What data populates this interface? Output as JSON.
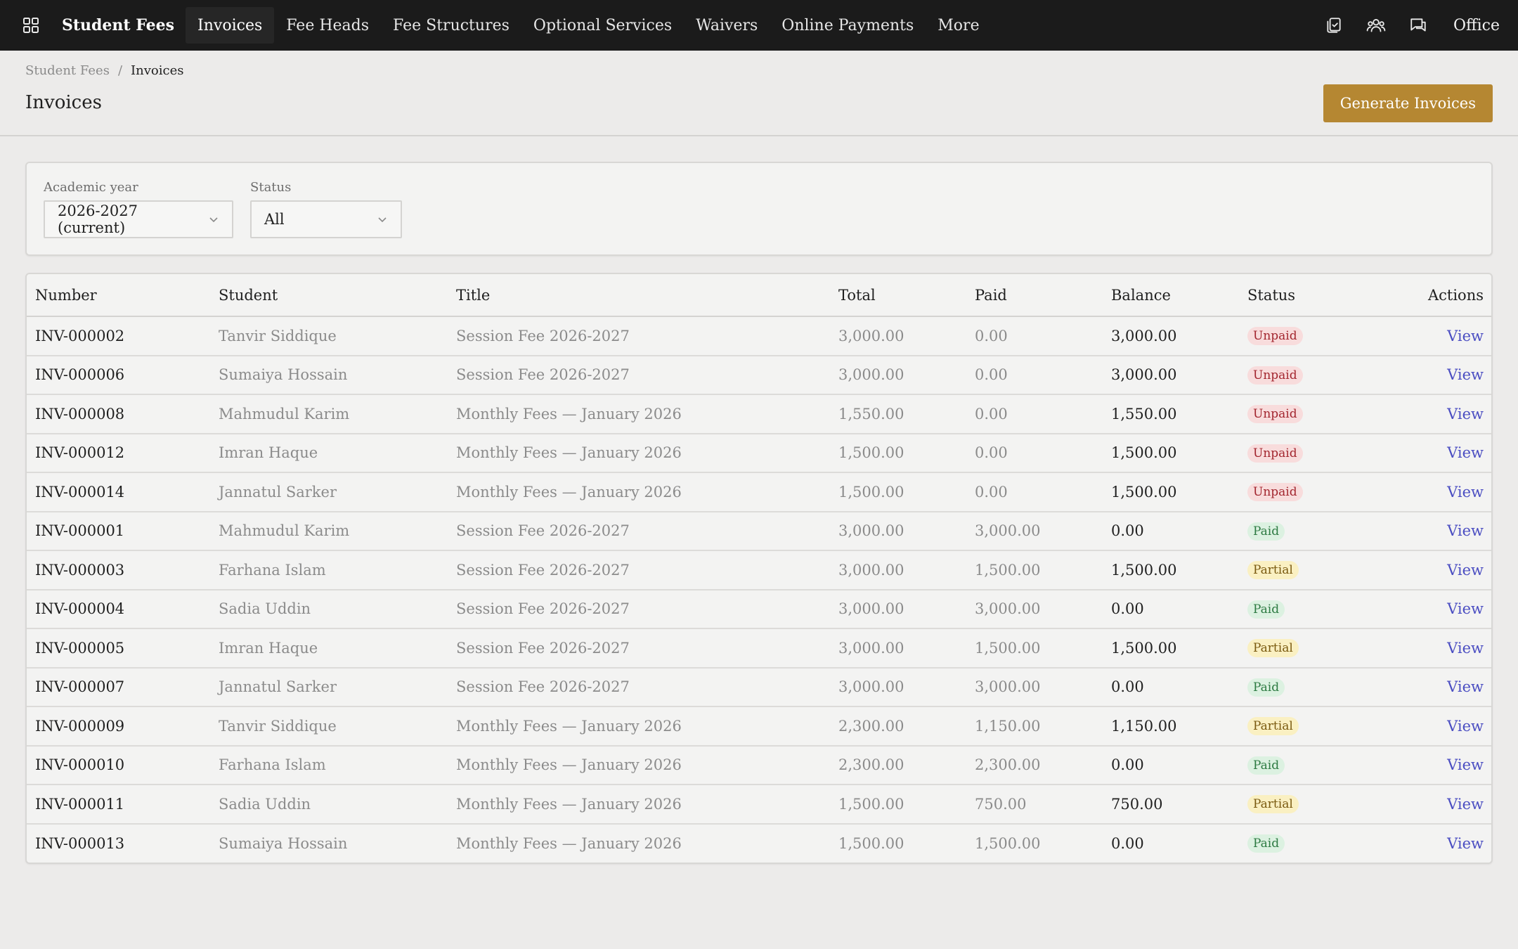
{
  "nav": {
    "brand": "Student Fees",
    "items": [
      {
        "label": "Invoices",
        "active": true
      },
      {
        "label": "Fee Heads",
        "active": false
      },
      {
        "label": "Fee Structures",
        "active": false
      },
      {
        "label": "Optional Services",
        "active": false
      },
      {
        "label": "Waivers",
        "active": false
      },
      {
        "label": "Online Payments",
        "active": false
      },
      {
        "label": "More",
        "active": false
      }
    ],
    "right_icons": [
      "clipboard-check-icon",
      "users-icon",
      "chat-icon"
    ],
    "user": "Office"
  },
  "breadcrumb": {
    "root": "Student Fees",
    "separator": "/",
    "current": "Invoices"
  },
  "page": {
    "title": "Invoices",
    "primary_button": "Generate Invoices"
  },
  "filters": {
    "year": {
      "label": "Academic year",
      "value": "2026-2027 (current)"
    },
    "status": {
      "label": "Status",
      "value": "All"
    }
  },
  "table": {
    "columns": {
      "number": "Number",
      "student": "Student",
      "title": "Title",
      "total": "Total",
      "paid": "Paid",
      "balance": "Balance",
      "status": "Status",
      "actions": "Actions"
    },
    "rows": [
      {
        "number": "INV-000002",
        "student": "Tanvir Siddique",
        "title": "Session Fee 2026-2027",
        "total": "3,000.00",
        "paid": "0.00",
        "balance": "3,000.00",
        "status": "Unpaid",
        "action": "View"
      },
      {
        "number": "INV-000006",
        "student": "Sumaiya Hossain",
        "title": "Session Fee 2026-2027",
        "total": "3,000.00",
        "paid": "0.00",
        "balance": "3,000.00",
        "status": "Unpaid",
        "action": "View"
      },
      {
        "number": "INV-000008",
        "student": "Mahmudul Karim",
        "title": "Monthly Fees — January 2026",
        "total": "1,550.00",
        "paid": "0.00",
        "balance": "1,550.00",
        "status": "Unpaid",
        "action": "View"
      },
      {
        "number": "INV-000012",
        "student": "Imran Haque",
        "title": "Monthly Fees — January 2026",
        "total": "1,500.00",
        "paid": "0.00",
        "balance": "1,500.00",
        "status": "Unpaid",
        "action": "View"
      },
      {
        "number": "INV-000014",
        "student": "Jannatul Sarker",
        "title": "Monthly Fees — January 2026",
        "total": "1,500.00",
        "paid": "0.00",
        "balance": "1,500.00",
        "status": "Unpaid",
        "action": "View"
      },
      {
        "number": "INV-000001",
        "student": "Mahmudul Karim",
        "title": "Session Fee 2026-2027",
        "total": "3,000.00",
        "paid": "3,000.00",
        "balance": "0.00",
        "status": "Paid",
        "action": "View"
      },
      {
        "number": "INV-000003",
        "student": "Farhana Islam",
        "title": "Session Fee 2026-2027",
        "total": "3,000.00",
        "paid": "1,500.00",
        "balance": "1,500.00",
        "status": "Partial",
        "action": "View"
      },
      {
        "number": "INV-000004",
        "student": "Sadia Uddin",
        "title": "Session Fee 2026-2027",
        "total": "3,000.00",
        "paid": "3,000.00",
        "balance": "0.00",
        "status": "Paid",
        "action": "View"
      },
      {
        "number": "INV-000005",
        "student": "Imran Haque",
        "title": "Session Fee 2026-2027",
        "total": "3,000.00",
        "paid": "1,500.00",
        "balance": "1,500.00",
        "status": "Partial",
        "action": "View"
      },
      {
        "number": "INV-000007",
        "student": "Jannatul Sarker",
        "title": "Session Fee 2026-2027",
        "total": "3,000.00",
        "paid": "3,000.00",
        "balance": "0.00",
        "status": "Paid",
        "action": "View"
      },
      {
        "number": "INV-000009",
        "student": "Tanvir Siddique",
        "title": "Monthly Fees — January 2026",
        "total": "2,300.00",
        "paid": "1,150.00",
        "balance": "1,150.00",
        "status": "Partial",
        "action": "View"
      },
      {
        "number": "INV-000010",
        "student": "Farhana Islam",
        "title": "Monthly Fees — January 2026",
        "total": "2,300.00",
        "paid": "2,300.00",
        "balance": "0.00",
        "status": "Paid",
        "action": "View"
      },
      {
        "number": "INV-000011",
        "student": "Sadia Uddin",
        "title": "Monthly Fees — January 2026",
        "total": "1,500.00",
        "paid": "750.00",
        "balance": "750.00",
        "status": "Partial",
        "action": "View"
      },
      {
        "number": "INV-000013",
        "student": "Sumaiya Hossain",
        "title": "Monthly Fees — January 2026",
        "total": "1,500.00",
        "paid": "1,500.00",
        "balance": "0.00",
        "status": "Paid",
        "action": "View"
      }
    ]
  },
  "status_colors": {
    "Unpaid": {
      "bg": "#f8dcdc",
      "fg": "#a3262f"
    },
    "Paid": {
      "bg": "#dcf1e1",
      "fg": "#2d7a42"
    },
    "Partial": {
      "bg": "#faf0c2",
      "fg": "#7a5a10"
    }
  },
  "colors": {
    "accent": "#b58732",
    "link": "#4b4ec2",
    "nav_bg": "#1b1b1b"
  }
}
